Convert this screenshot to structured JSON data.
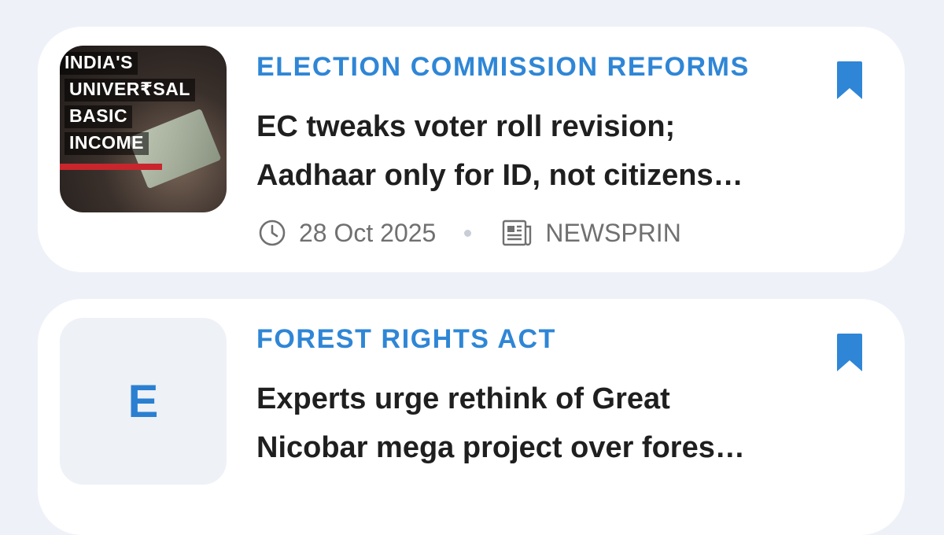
{
  "articles": [
    {
      "category": "ELECTION COMMISSION REFORMS",
      "headline_line1": "EC tweaks voter roll revision;",
      "headline_line2": "Aadhaar only for ID, not citizens…",
      "date": "28 Oct 2025",
      "source": "NEWSPRIN",
      "thumbnail": {
        "line1": "INDIA'S",
        "line2": "UNIVER₹SAL",
        "line3": "BASIC",
        "line4": "INCOME"
      }
    },
    {
      "category": "FOREST RIGHTS ACT",
      "headline_line1": "Experts urge rethink of Great",
      "headline_line2": "Nicobar mega project over fores…",
      "thumbnail_letter": "E"
    }
  ],
  "colors": {
    "accent": "#2f86d6",
    "background": "#eef2f8",
    "card": "#ffffff"
  },
  "icons": {
    "bookmark": "bookmark-icon",
    "clock": "clock-icon",
    "source": "newspaper-icon"
  }
}
